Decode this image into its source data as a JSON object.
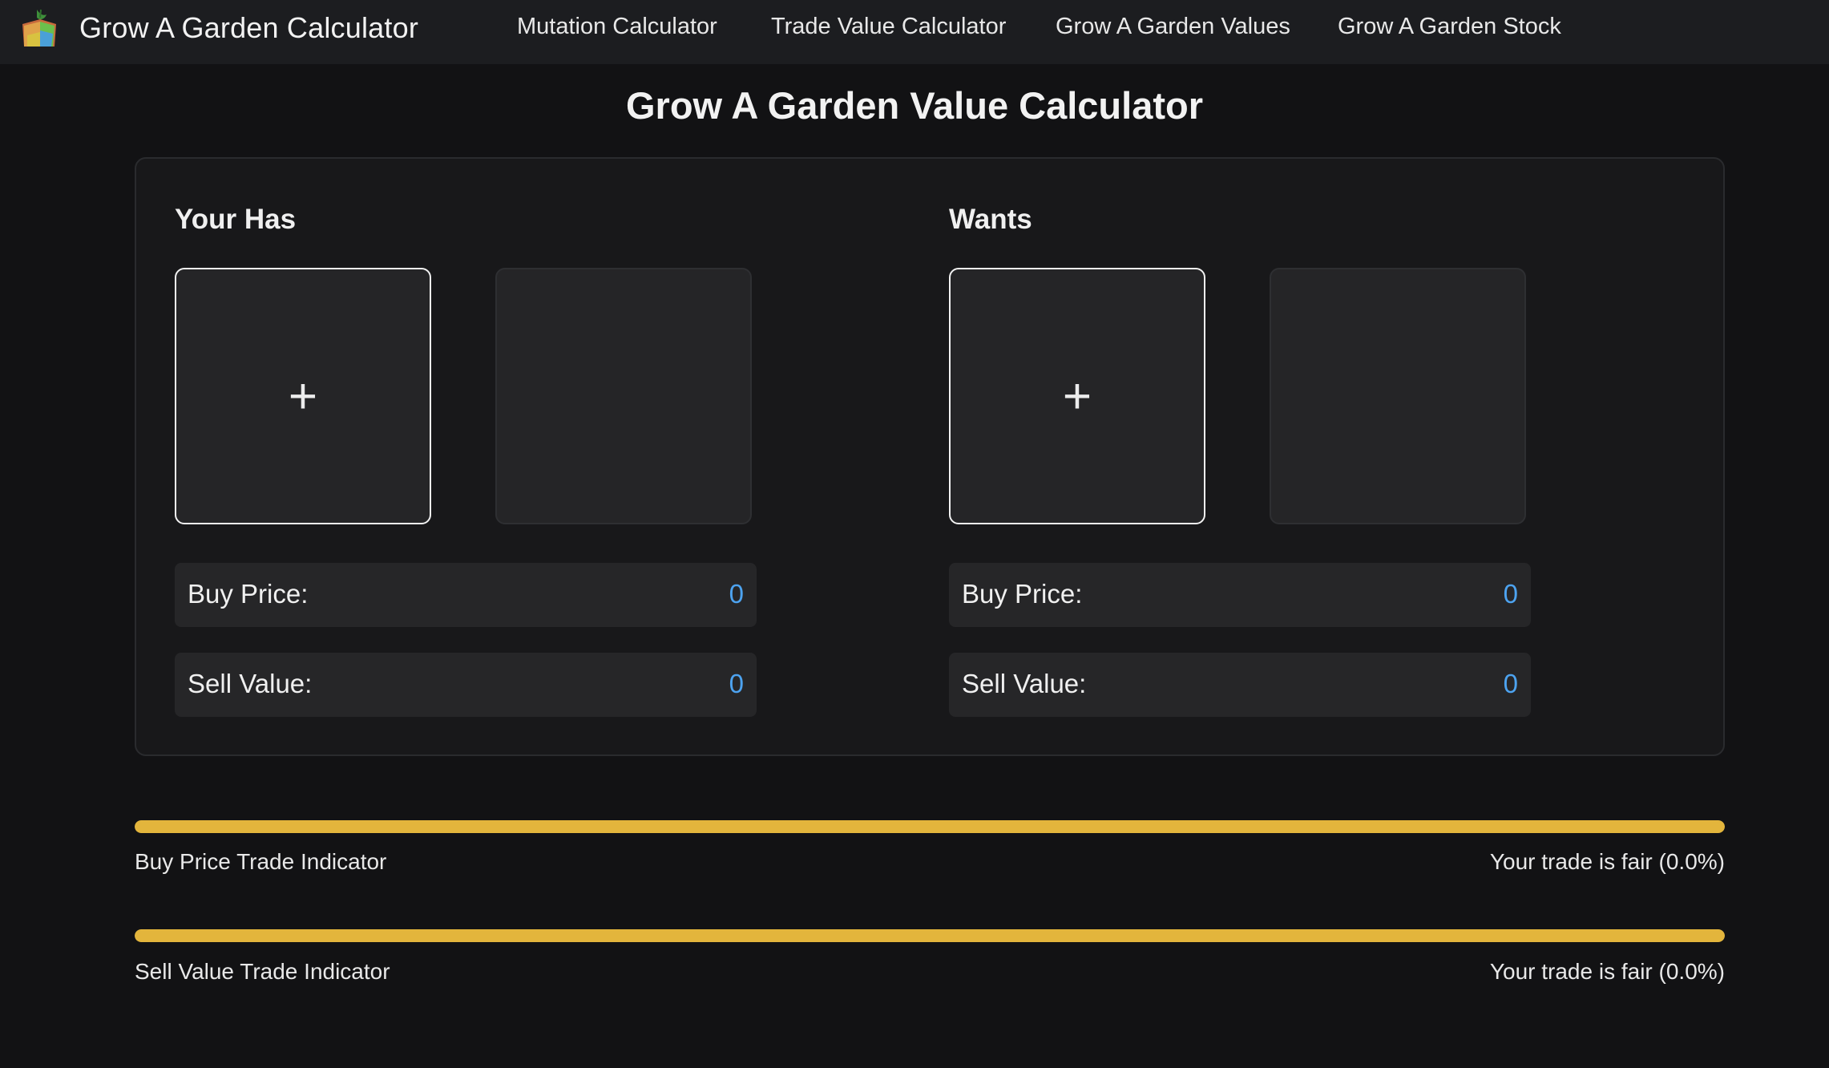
{
  "header": {
    "brand": "Grow A Garden Calculator",
    "logo_icon": "garden-crate-icon",
    "nav": [
      {
        "label": "Mutation Calculator"
      },
      {
        "label": "Trade Value Calculator"
      },
      {
        "label": "Grow A Garden Values"
      },
      {
        "label": "Grow A Garden Stock"
      }
    ]
  },
  "main": {
    "title": "Grow A Garden Value Calculator",
    "has": {
      "title": "Your Has",
      "add_symbol": "+",
      "buy_label": "Buy Price:",
      "buy_value": "0",
      "sell_label": "Sell Value:",
      "sell_value": "0"
    },
    "wants": {
      "title": "Wants",
      "add_symbol": "+",
      "buy_label": "Buy Price:",
      "buy_value": "0",
      "sell_label": "Sell Value:",
      "sell_value": "0"
    }
  },
  "indicators": [
    {
      "label": "Buy Price Trade Indicator",
      "status": "Your trade is fair (0.0%)",
      "fill": 1.0,
      "color": "#e3b53c"
    },
    {
      "label": "Sell Value Trade Indicator",
      "status": "Your trade is fair (0.0%)",
      "fill": 1.0,
      "color": "#e3b53c"
    }
  ],
  "colors": {
    "background": "#121214",
    "navbar": "#1c1d20",
    "accent_value": "#4da3f0",
    "indicator_fair": "#e3b53c"
  }
}
